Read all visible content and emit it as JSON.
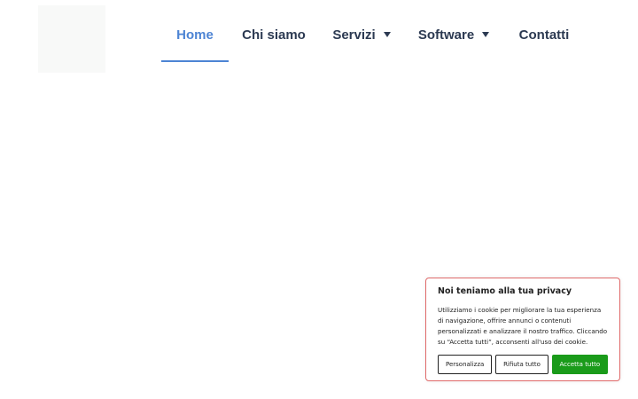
{
  "nav": {
    "items": [
      {
        "label": "Home",
        "active": true
      },
      {
        "label": "Chi siamo",
        "active": false
      },
      {
        "label": "Servizi",
        "has_dropdown": true
      },
      {
        "label": "Software",
        "has_dropdown": true
      },
      {
        "label": "Contatti",
        "active": false
      }
    ],
    "active_color": "#4d84d4",
    "text_color": "#2c3a52"
  },
  "cookie_banner": {
    "title": "Noi teniamo alla tua privacy",
    "text": "Utilizziamo i cookie per migliorare la tua esperienza di navigazione, offrire annunci o contenuti personalizzati e analizzare il nostro traffico. Cliccando su “Accetta tutti”, acconsenti all'uso dei cookie.",
    "buttons": {
      "customize": "Personalizza",
      "reject": "Rifiuta tutto",
      "accept": "Accetta tutto"
    },
    "accept_color": "#1a9b1a",
    "border_color": "#e06a6a"
  }
}
